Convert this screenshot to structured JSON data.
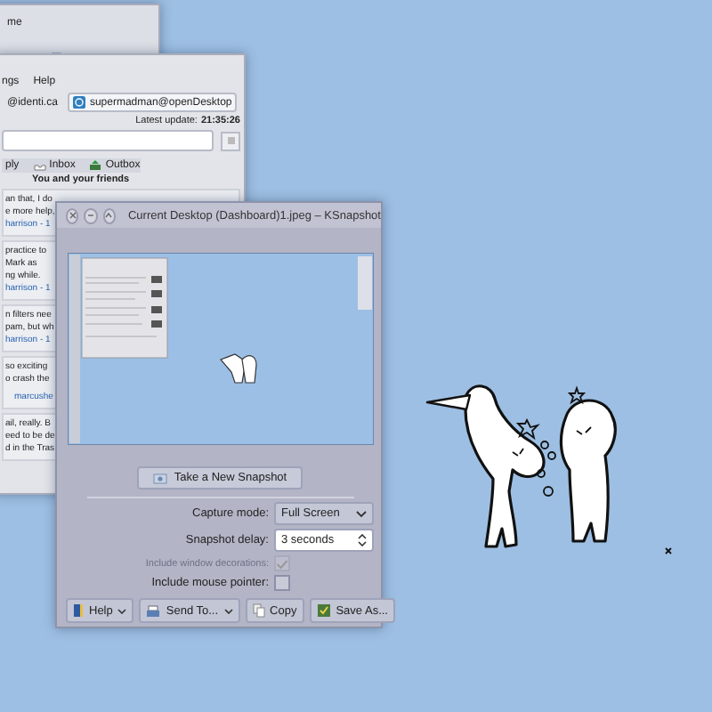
{
  "back_window": {
    "title": "me"
  },
  "client_window": {
    "menu": [
      "ngs",
      "Help"
    ],
    "accounts": [
      {
        "label": "@identi.ca",
        "selected": false
      },
      {
        "label": "supermadman@openDesktop",
        "selected": true
      }
    ],
    "latest_update_label": "Latest update:",
    "latest_update": "21:35:26",
    "tabs": [
      "ply",
      "Inbox",
      "Outbox"
    ],
    "timeline_title": "You and your friends",
    "posts": [
      {
        "lines": [
          "an that, I do",
          "e more help,"
        ],
        "author": "harrison - 1"
      },
      {
        "lines": [
          "practice to",
          "Mark as",
          "ng while."
        ],
        "author": "harrison - 1"
      },
      {
        "lines": [
          "n filters nee",
          "pam, but wh"
        ],
        "author": "harrison - 1"
      },
      {
        "lines": [
          "so exciting",
          "o crash the"
        ],
        "author": "marcushe"
      },
      {
        "lines": [
          "ail, really. B",
          "eed to be de",
          "d in the Tras"
        ]
      }
    ]
  },
  "ksnapshot": {
    "title": "Current Desktop (Dashboard)1.jpeg – KSnapshot",
    "new_snapshot": "Take a New Snapshot",
    "capture_mode": {
      "label": "Capture mode:",
      "value": "Full Screen"
    },
    "delay": {
      "label": "Snapshot delay:",
      "value": "3 seconds"
    },
    "options": [
      {
        "label": "Include window decorations:",
        "checked": true,
        "disabled": true
      },
      {
        "label": "Include mouse pointer:",
        "checked": false,
        "disabled": false
      }
    ],
    "buttons": [
      {
        "label": "Help",
        "menu": true
      },
      {
        "label": "Send To...",
        "menu": true
      },
      {
        "label": "Copy",
        "menu": false
      },
      {
        "label": "Save As...",
        "menu": false
      }
    ]
  }
}
